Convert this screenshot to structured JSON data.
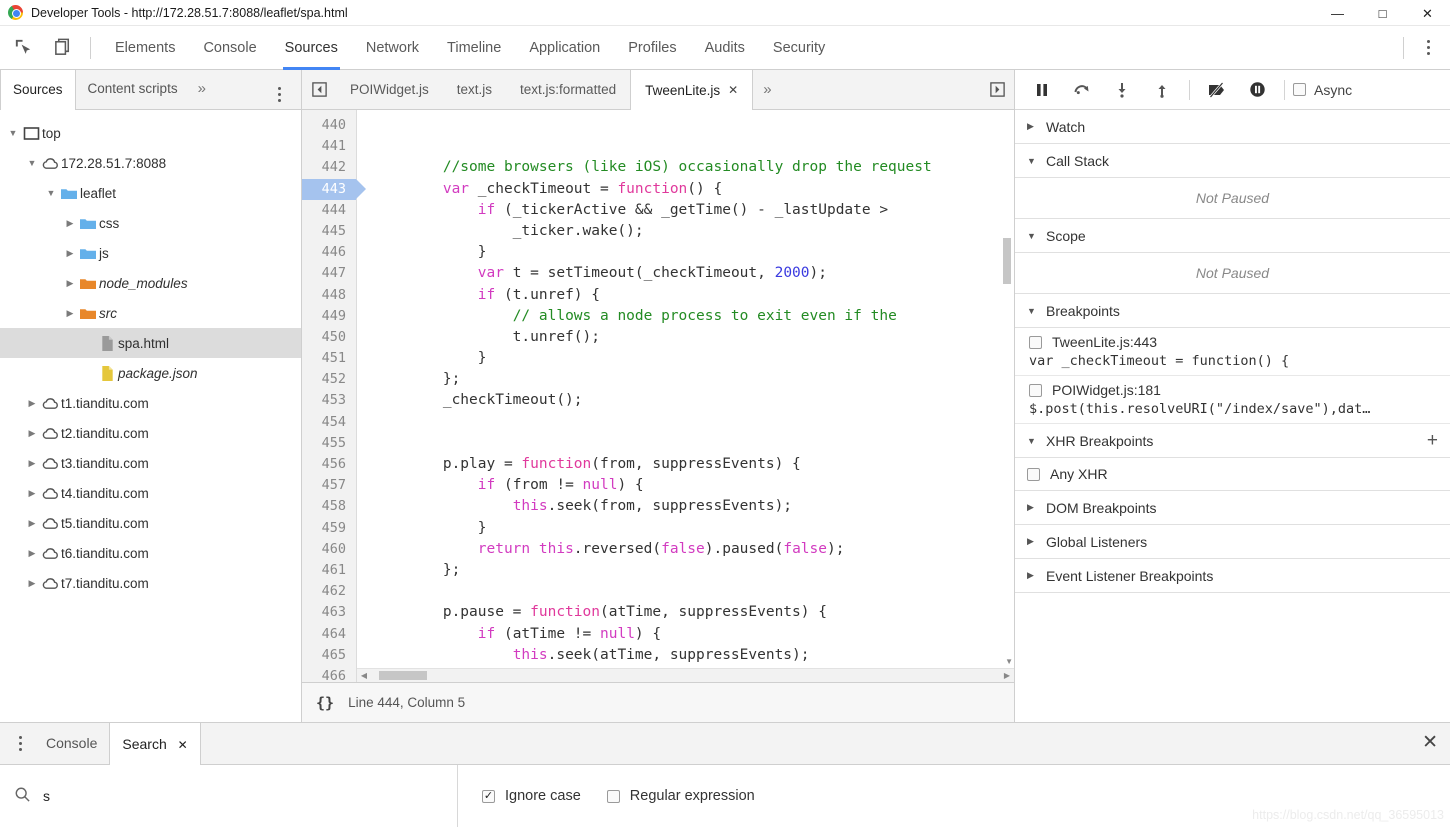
{
  "window": {
    "title": "Developer Tools - http://172.28.51.7:8088/leaflet/spa.html",
    "minimize": "—",
    "maximize": "□",
    "close": "✕"
  },
  "main_tabs": {
    "inspect_icon": "inspect-element-icon",
    "device_icon": "device-toolbar-icon",
    "items": [
      {
        "label": "Elements",
        "active": false
      },
      {
        "label": "Console",
        "active": false
      },
      {
        "label": "Sources",
        "active": true
      },
      {
        "label": "Network",
        "active": false
      },
      {
        "label": "Timeline",
        "active": false
      },
      {
        "label": "Application",
        "active": false
      },
      {
        "label": "Profiles",
        "active": false
      },
      {
        "label": "Audits",
        "active": false
      },
      {
        "label": "Security",
        "active": false
      }
    ]
  },
  "navigator": {
    "tabs": [
      {
        "label": "Sources",
        "active": true
      },
      {
        "label": "Content scripts",
        "active": false
      }
    ],
    "more": "»",
    "tree": [
      {
        "label": "top",
        "icon": "frame-icon",
        "caret": "▼",
        "indent": 0,
        "italic": false,
        "selected": false
      },
      {
        "label": "172.28.51.7:8088",
        "icon": "cloud-icon",
        "caret": "▼",
        "indent": 1,
        "italic": false,
        "selected": false
      },
      {
        "label": "leaflet",
        "icon": "folder-blue-icon",
        "caret": "▼",
        "indent": 2,
        "italic": false,
        "selected": false
      },
      {
        "label": "css",
        "icon": "folder-blue-icon",
        "caret": "▶",
        "indent": 3,
        "italic": false,
        "selected": false
      },
      {
        "label": "js",
        "icon": "folder-blue-icon",
        "caret": "▶",
        "indent": 3,
        "italic": false,
        "selected": false
      },
      {
        "label": "node_modules",
        "icon": "folder-orange-icon",
        "caret": "▶",
        "indent": 3,
        "italic": true,
        "selected": false
      },
      {
        "label": "src",
        "icon": "folder-orange-icon",
        "caret": "▶",
        "indent": 3,
        "italic": true,
        "selected": false
      },
      {
        "label": "spa.html",
        "icon": "file-gray-icon",
        "caret": "",
        "indent": 4,
        "italic": false,
        "selected": true
      },
      {
        "label": "package.json",
        "icon": "file-yellow-icon",
        "caret": "",
        "indent": 4,
        "italic": true,
        "selected": false
      },
      {
        "label": "t1.tianditu.com",
        "icon": "cloud-icon",
        "caret": "▶",
        "indent": 1,
        "italic": false,
        "selected": false
      },
      {
        "label": "t2.tianditu.com",
        "icon": "cloud-icon",
        "caret": "▶",
        "indent": 1,
        "italic": false,
        "selected": false
      },
      {
        "label": "t3.tianditu.com",
        "icon": "cloud-icon",
        "caret": "▶",
        "indent": 1,
        "italic": false,
        "selected": false
      },
      {
        "label": "t4.tianditu.com",
        "icon": "cloud-icon",
        "caret": "▶",
        "indent": 1,
        "italic": false,
        "selected": false
      },
      {
        "label": "t5.tianditu.com",
        "icon": "cloud-icon",
        "caret": "▶",
        "indent": 1,
        "italic": false,
        "selected": false
      },
      {
        "label": "t6.tianditu.com",
        "icon": "cloud-icon",
        "caret": "▶",
        "indent": 1,
        "italic": false,
        "selected": false
      },
      {
        "label": "t7.tianditu.com",
        "icon": "cloud-icon",
        "caret": "▶",
        "indent": 1,
        "italic": false,
        "selected": false
      }
    ]
  },
  "editor": {
    "tabs": [
      {
        "label": "POIWidget.js",
        "active": false,
        "closable": false
      },
      {
        "label": "text.js",
        "active": false,
        "closable": false
      },
      {
        "label": "text.js:formatted",
        "active": false,
        "closable": false
      },
      {
        "label": "TweenLite.js",
        "active": true,
        "closable": true
      }
    ],
    "close_glyph": "✕",
    "more": "»",
    "first_line_number": 440,
    "current_line": 443,
    "lines": [
      {
        "n": 440,
        "tokens": []
      },
      {
        "n": 441,
        "tokens": []
      },
      {
        "n": 442,
        "tokens": [
          {
            "t": "\t\t",
            "c": "plain"
          },
          {
            "t": "//some browsers (like iOS) occasionally drop the request",
            "c": "cmt"
          }
        ]
      },
      {
        "n": 443,
        "tokens": [
          {
            "t": "\t\t",
            "c": "plain"
          },
          {
            "t": "var",
            "c": "kw"
          },
          {
            "t": " _checkTimeout = ",
            "c": "plain"
          },
          {
            "t": "function",
            "c": "kw2"
          },
          {
            "t": "() {",
            "c": "plain"
          }
        ]
      },
      {
        "n": 444,
        "tokens": [
          {
            "t": "\t\t    ",
            "c": "plain"
          },
          {
            "t": "if",
            "c": "kw"
          },
          {
            "t": " (_tickerActive && _getTime() - _lastUpdate >",
            "c": "plain"
          }
        ]
      },
      {
        "n": 445,
        "tokens": [
          {
            "t": "\t\t        _ticker.wake();",
            "c": "plain"
          }
        ]
      },
      {
        "n": 446,
        "tokens": [
          {
            "t": "\t\t    }",
            "c": "plain"
          }
        ]
      },
      {
        "n": 447,
        "tokens": [
          {
            "t": "\t\t    ",
            "c": "plain"
          },
          {
            "t": "var",
            "c": "kw"
          },
          {
            "t": " t = setTimeout(_checkTimeout, ",
            "c": "plain"
          },
          {
            "t": "2000",
            "c": "num"
          },
          {
            "t": ");",
            "c": "plain"
          }
        ]
      },
      {
        "n": 448,
        "tokens": [
          {
            "t": "\t\t    ",
            "c": "plain"
          },
          {
            "t": "if",
            "c": "kw"
          },
          {
            "t": " (t.unref) {",
            "c": "plain"
          }
        ]
      },
      {
        "n": 449,
        "tokens": [
          {
            "t": "\t\t        ",
            "c": "plain"
          },
          {
            "t": "// allows a node process to exit even if the",
            "c": "cmt"
          }
        ]
      },
      {
        "n": 450,
        "tokens": [
          {
            "t": "\t\t        t.unref();",
            "c": "plain"
          }
        ]
      },
      {
        "n": 451,
        "tokens": [
          {
            "t": "\t\t    }",
            "c": "plain"
          }
        ]
      },
      {
        "n": 452,
        "tokens": [
          {
            "t": "\t\t};",
            "c": "plain"
          }
        ]
      },
      {
        "n": 453,
        "tokens": [
          {
            "t": "\t\t_checkTimeout();",
            "c": "plain"
          }
        ]
      },
      {
        "n": 454,
        "tokens": []
      },
      {
        "n": 455,
        "tokens": []
      },
      {
        "n": 456,
        "tokens": [
          {
            "t": "\t\tp.play = ",
            "c": "plain"
          },
          {
            "t": "function",
            "c": "kw2"
          },
          {
            "t": "(from, suppressEvents) {",
            "c": "plain"
          }
        ]
      },
      {
        "n": 457,
        "tokens": [
          {
            "t": "\t\t    ",
            "c": "plain"
          },
          {
            "t": "if",
            "c": "kw"
          },
          {
            "t": " (from != ",
            "c": "plain"
          },
          {
            "t": "null",
            "c": "kw"
          },
          {
            "t": ") {",
            "c": "plain"
          }
        ]
      },
      {
        "n": 458,
        "tokens": [
          {
            "t": "\t\t        ",
            "c": "plain"
          },
          {
            "t": "this",
            "c": "kw"
          },
          {
            "t": ".seek(from, suppressEvents);",
            "c": "plain"
          }
        ]
      },
      {
        "n": 459,
        "tokens": [
          {
            "t": "\t\t    }",
            "c": "plain"
          }
        ]
      },
      {
        "n": 460,
        "tokens": [
          {
            "t": "\t\t    ",
            "c": "plain"
          },
          {
            "t": "return this",
            "c": "kw"
          },
          {
            "t": ".reversed(",
            "c": "plain"
          },
          {
            "t": "false",
            "c": "kw"
          },
          {
            "t": ").paused(",
            "c": "plain"
          },
          {
            "t": "false",
            "c": "kw"
          },
          {
            "t": ");",
            "c": "plain"
          }
        ]
      },
      {
        "n": 461,
        "tokens": [
          {
            "t": "\t\t};",
            "c": "plain"
          }
        ]
      },
      {
        "n": 462,
        "tokens": []
      },
      {
        "n": 463,
        "tokens": [
          {
            "t": "\t\tp.pause = ",
            "c": "plain"
          },
          {
            "t": "function",
            "c": "kw2"
          },
          {
            "t": "(atTime, suppressEvents) {",
            "c": "plain"
          }
        ]
      },
      {
        "n": 464,
        "tokens": [
          {
            "t": "\t\t    ",
            "c": "plain"
          },
          {
            "t": "if",
            "c": "kw"
          },
          {
            "t": " (atTime != ",
            "c": "plain"
          },
          {
            "t": "null",
            "c": "kw"
          },
          {
            "t": ") {",
            "c": "plain"
          }
        ]
      },
      {
        "n": 465,
        "tokens": [
          {
            "t": "\t\t        ",
            "c": "plain"
          },
          {
            "t": "this",
            "c": "kw"
          },
          {
            "t": ".seek(atTime, suppressEvents);",
            "c": "plain"
          }
        ]
      },
      {
        "n": 466,
        "tokens": [
          {
            "t": "\t\t    }",
            "c": "plain"
          }
        ]
      }
    ],
    "status": {
      "format_icon": "{}",
      "position": "Line 444, Column 5"
    }
  },
  "debugger": {
    "toolbar": [
      {
        "name": "pause-resume-button",
        "icon": "pause-icon"
      },
      {
        "name": "step-over-button",
        "icon": "step-over-icon"
      },
      {
        "name": "step-into-button",
        "icon": "step-into-icon"
      },
      {
        "name": "step-out-button",
        "icon": "step-out-icon"
      },
      {
        "name": "deactivate-breakpoints-button",
        "icon": "deactivate-breakpoints-icon"
      },
      {
        "name": "pause-on-exceptions-button",
        "icon": "pause-on-exceptions-icon"
      }
    ],
    "async_label": "Async",
    "async_checked": false,
    "sections": {
      "watch": {
        "label": "Watch",
        "expanded": false,
        "caret": "▶"
      },
      "call_stack": {
        "label": "Call Stack",
        "expanded": true,
        "caret": "▼",
        "empty_text": "Not Paused"
      },
      "scope": {
        "label": "Scope",
        "expanded": true,
        "caret": "▼",
        "empty_text": "Not Paused"
      },
      "breakpoints": {
        "label": "Breakpoints",
        "expanded": true,
        "caret": "▼"
      },
      "xhr_breakpoints": {
        "label": "XHR Breakpoints",
        "expanded": true,
        "caret": "▼",
        "add": "+"
      },
      "dom_breakpoints": {
        "label": "DOM Breakpoints",
        "expanded": false,
        "caret": "▶"
      },
      "global_listeners": {
        "label": "Global Listeners",
        "expanded": false,
        "caret": "▶"
      },
      "event_listener_breakpoints": {
        "label": "Event Listener Breakpoints",
        "expanded": false,
        "caret": "▶"
      }
    },
    "breakpoints": [
      {
        "location": "TweenLite.js:443",
        "checked": false,
        "code": "var _checkTimeout = function() {"
      },
      {
        "location": "POIWidget.js:181",
        "checked": false,
        "code": "$.post(this.resolveURI(\"/index/save\"),dat…"
      }
    ],
    "xhr_breakpoints": [
      {
        "label": "Any XHR",
        "checked": false
      }
    ]
  },
  "drawer": {
    "tabs": [
      {
        "label": "Console",
        "active": false,
        "closable": false
      },
      {
        "label": "Search",
        "active": true,
        "closable": true
      }
    ],
    "close_glyph": "✕",
    "panel_close": "✕",
    "search": {
      "icon": "search-icon",
      "value": "s",
      "placeholder": "",
      "options": [
        {
          "label": "Ignore case",
          "checked": true
        },
        {
          "label": "Regular expression",
          "checked": false
        }
      ]
    }
  },
  "watermark": "https://blog.csdn.net/qq_36595013"
}
